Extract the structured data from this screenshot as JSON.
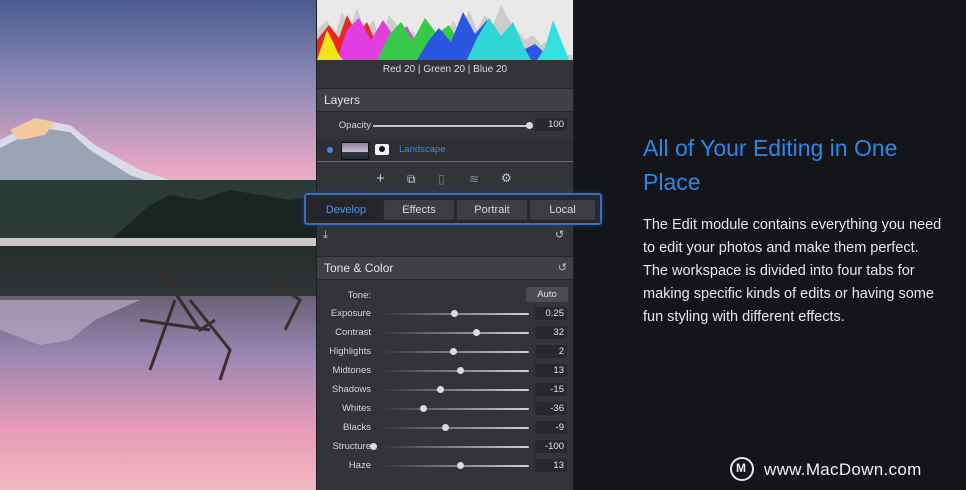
{
  "histogram": {
    "readout": {
      "red_label": "Red",
      "red_value": "20",
      "green_label": "Green",
      "green_value": "20",
      "blue_label": "Blue",
      "blue_value": "20"
    }
  },
  "layers": {
    "title": "Layers",
    "opacity_label": "Opacity",
    "opacity_value": "100",
    "opacity_fraction": 1.0,
    "layer_name": "Landscape",
    "tools": [
      "plus-icon",
      "duplicate-icon",
      "copy-icon",
      "stack-icon",
      "gear-icon"
    ]
  },
  "tabs": [
    {
      "label": "Develop",
      "active": true
    },
    {
      "label": "Effects",
      "active": false
    },
    {
      "label": "Portrait",
      "active": false
    },
    {
      "label": "Local",
      "active": false
    }
  ],
  "tone_color": {
    "title": "Tone & Color",
    "tone_label": "Tone:",
    "auto_label": "Auto",
    "sliders": [
      {
        "label": "Exposure",
        "value": "0.25",
        "fraction": 0.52
      },
      {
        "label": "Contrast",
        "value": "32",
        "fraction": 0.66
      },
      {
        "label": "Highlights",
        "value": "2",
        "fraction": 0.51
      },
      {
        "label": "Midtones",
        "value": "13",
        "fraction": 0.56
      },
      {
        "label": "Shadows",
        "value": "-15",
        "fraction": 0.43
      },
      {
        "label": "Whites",
        "value": "-36",
        "fraction": 0.32
      },
      {
        "label": "Blacks",
        "value": "-9",
        "fraction": 0.46
      },
      {
        "label": "Structure",
        "value": "-100",
        "fraction": 0.0
      },
      {
        "label": "Haze",
        "value": "13",
        "fraction": 0.56
      }
    ]
  },
  "article": {
    "heading": "All of Your Editing in One Place",
    "body": "The Edit module contains everything you need to edit your photos and make them perfect. The workspace is divided into four tabs for making specific kinds of edits or having some fun styling with different effects."
  },
  "watermark": {
    "logo_letter": "M",
    "text": "www.MacDown.com"
  }
}
